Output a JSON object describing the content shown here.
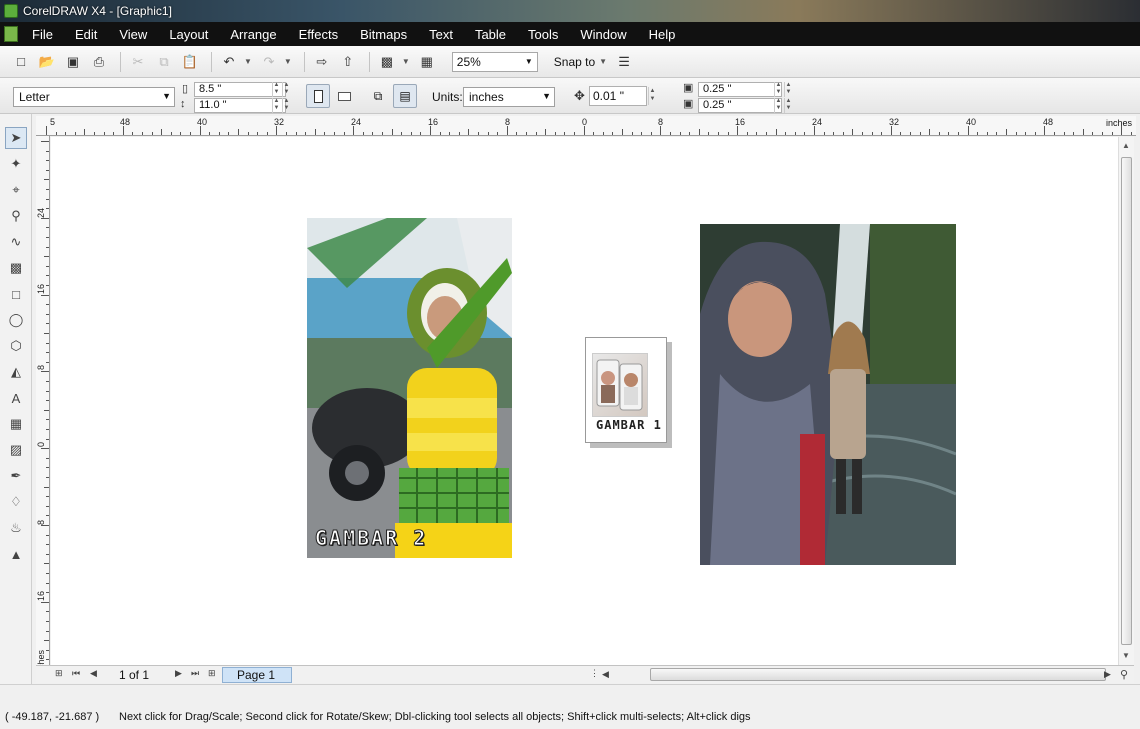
{
  "window": {
    "title": "CorelDRAW X4 - [Graphic1]"
  },
  "menu": [
    {
      "label": "File"
    },
    {
      "label": "Edit"
    },
    {
      "label": "View"
    },
    {
      "label": "Layout"
    },
    {
      "label": "Arrange"
    },
    {
      "label": "Effects"
    },
    {
      "label": "Bitmaps"
    },
    {
      "label": "Text"
    },
    {
      "label": "Table"
    },
    {
      "label": "Tools"
    },
    {
      "label": "Window"
    },
    {
      "label": "Help"
    }
  ],
  "standard_toolbar": {
    "zoom": "25%",
    "snap_to": "Snap to"
  },
  "property_bar": {
    "paper": "Letter",
    "width": "8.5 \"",
    "height": "11.0 \"",
    "units_label": "Units:",
    "units": "inches",
    "nudge": "0.01 \"",
    "dup_x": "0.25 \"",
    "dup_y": "0.25 \""
  },
  "ruler": {
    "h_labels": [
      "5",
      "48",
      "40",
      "32",
      "24",
      "16",
      "8",
      "0",
      "8",
      "16",
      "24",
      "32",
      "40",
      "48"
    ],
    "h_unit": "inches",
    "v_labels": [
      "24",
      "16",
      "8",
      "0",
      "8",
      "16"
    ],
    "v_unit": "inches"
  },
  "canvas": {
    "photo_left_caption": "GAMBAR 2",
    "thumb_caption": "GAMBAR 1"
  },
  "page_nav": {
    "count": "1 of 1",
    "tab": "Page 1"
  },
  "status": {
    "coords": "( -49.187, -21.687 )",
    "message": "Next click for Drag/Scale; Second click for Rotate/Skew; Dbl-clicking tool selects all objects; Shift+click multi-selects; Alt+click digs"
  }
}
